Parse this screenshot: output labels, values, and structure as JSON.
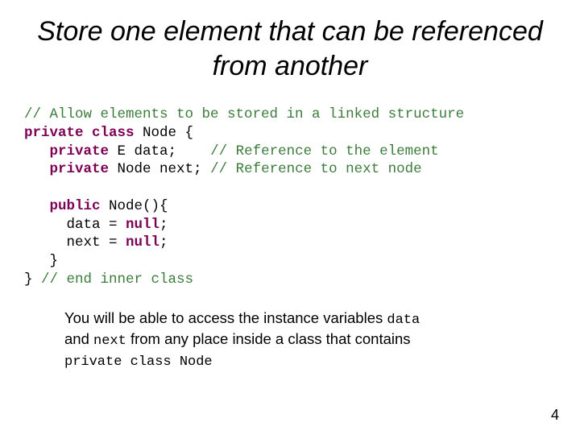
{
  "title": "Store one element that can be referenced from another",
  "code": {
    "c1": "// Allow elements to be stored in a linked structure",
    "kw_private1": "private",
    "kw_class": "class",
    "t_node_decl": " Node {",
    "kw_private2": "private",
    "t_e_data": " E data;    ",
    "c2": "// Reference to the element",
    "kw_private3": "private",
    "t_node_next": " Node next; ",
    "c3": "// Reference to next node",
    "kw_public": "public",
    "t_ctor": " Node(){",
    "t_data_assign": "     data = ",
    "kw_null1": "null",
    "t_semi1": ";",
    "t_next_assign": "     next = ",
    "kw_null2": "null",
    "t_semi2": ";",
    "t_closebrace1": "   }",
    "t_closebrace2": "} ",
    "c4": "// end inner class"
  },
  "note": {
    "p1": "You will be able to access the instance variables ",
    "m1": "data",
    "p2": " and ",
    "m2": "next",
    "p3": " from any place inside a class that contains ",
    "m3": "private class Node"
  },
  "pagenum": "4"
}
